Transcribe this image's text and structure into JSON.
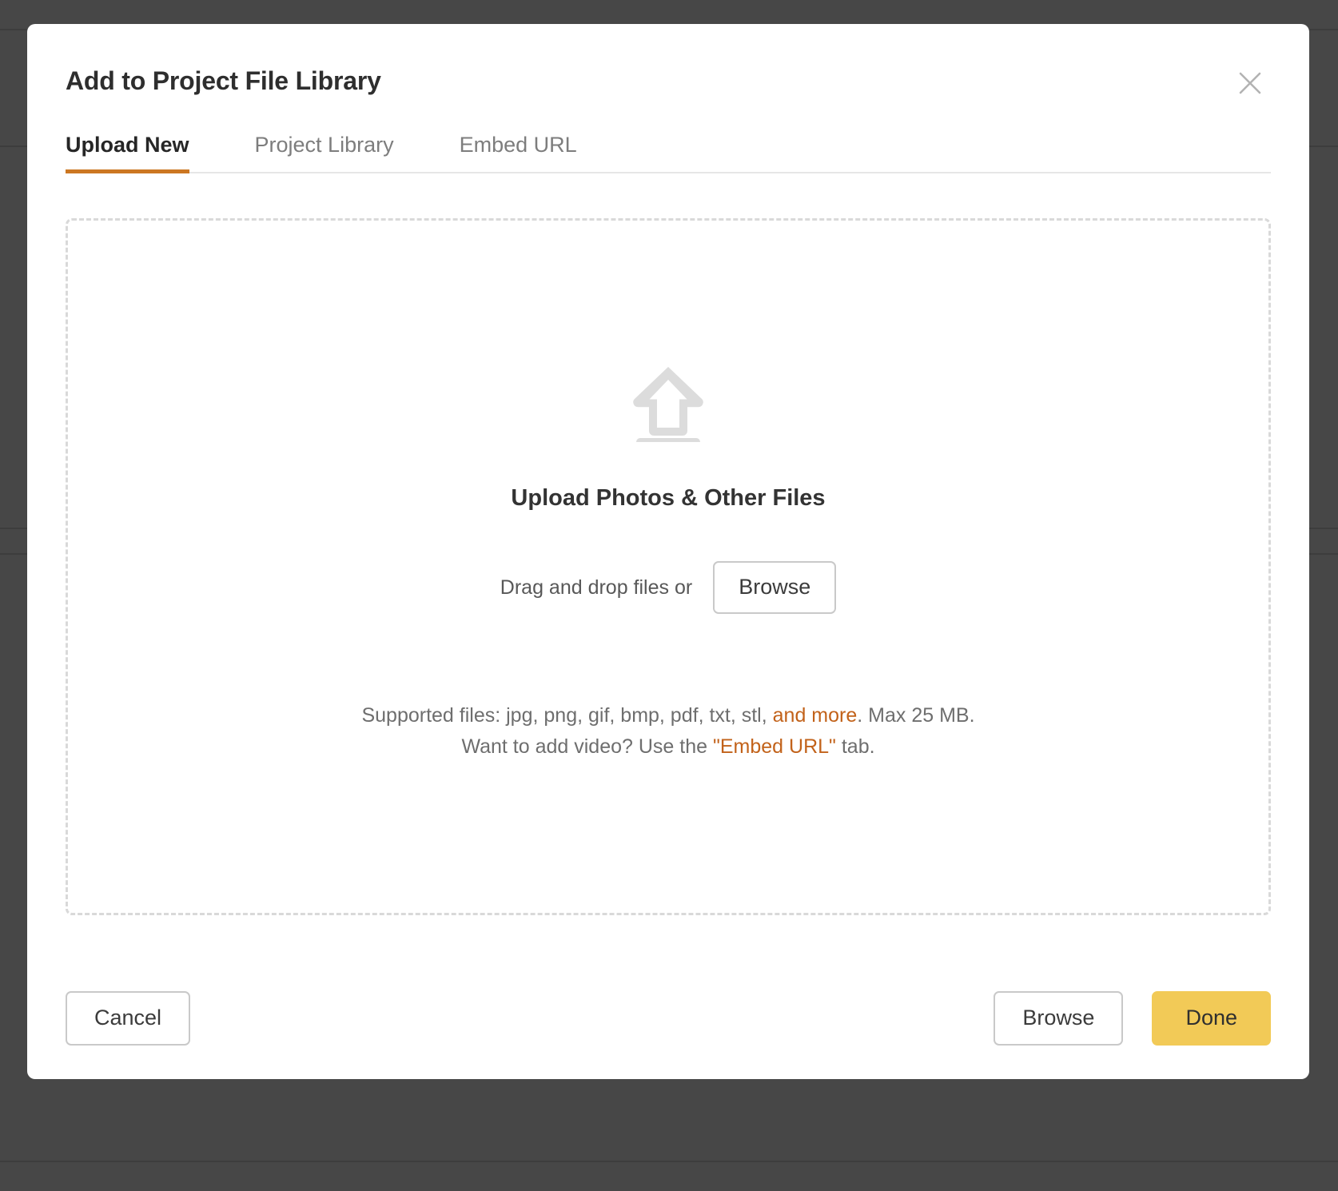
{
  "overlay": {
    "backdrop_color": "#474747"
  },
  "modal": {
    "title": "Add to Project File Library",
    "close_icon": "close-icon",
    "tabs": [
      {
        "label": "Upload New",
        "active": true
      },
      {
        "label": "Project Library",
        "active": false
      },
      {
        "label": "Embed URL",
        "active": false
      }
    ],
    "active_tab_underline_color": "#cc7722",
    "dropzone": {
      "icon": "upload-arrow-icon",
      "title": "Upload Photos & Other Files",
      "drag_label": "Drag and drop files or",
      "browse_label": "Browse",
      "supported_line1_prefix": "Supported files: jpg, png, gif, bmp, pdf, txt, stl, ",
      "supported_line1_link": "and more",
      "supported_line1_suffix": ". Max 25 MB.",
      "supported_line2_prefix": "Want to add video? Use the ",
      "supported_line2_link": "\"Embed URL\"",
      "supported_line2_suffix": " tab.",
      "link_color": "#c2621a"
    },
    "footer": {
      "cancel_label": "Cancel",
      "browse_label": "Browse",
      "done_label": "Done",
      "done_color": "#f2ca57"
    }
  }
}
